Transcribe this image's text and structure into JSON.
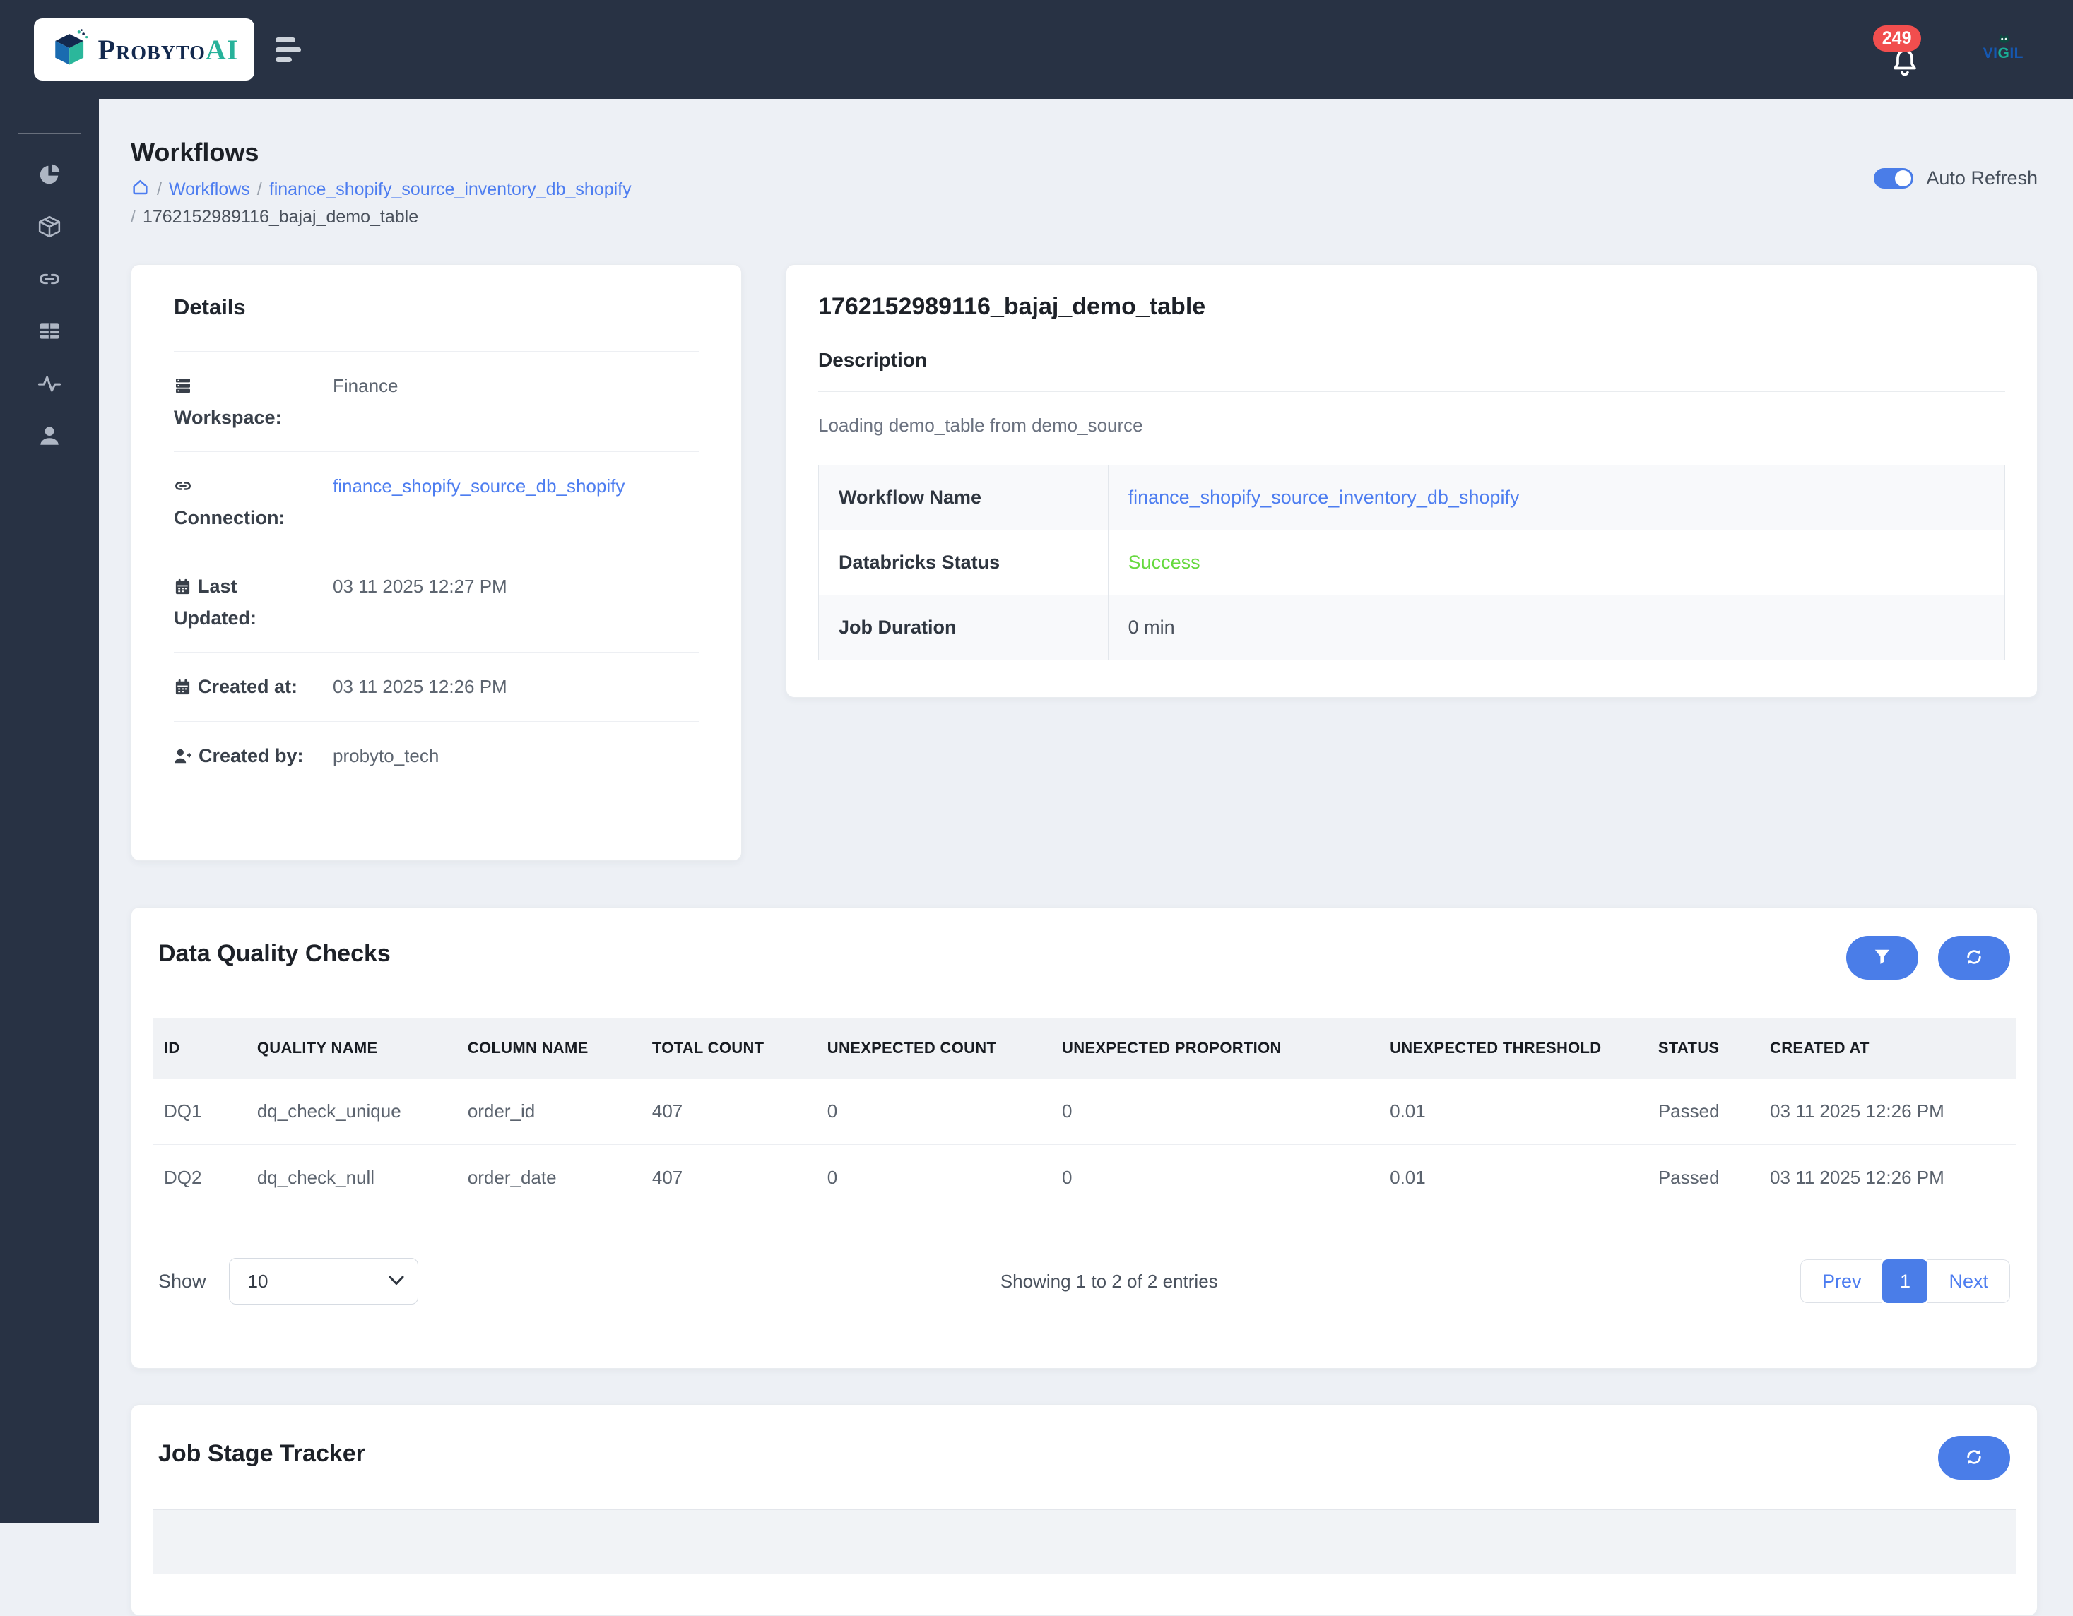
{
  "navbar": {
    "brand_name": "Probyto",
    "brand_suffix": "AI",
    "notification_count": "249",
    "vigil_label": "VIGIL"
  },
  "sidebar": {
    "icons": [
      "pie-chart",
      "package",
      "link",
      "table",
      "activity",
      "user"
    ]
  },
  "page": {
    "title": "Workflows",
    "breadcrumb": {
      "sep": "/",
      "items": [
        "Workflows",
        "finance_shopify_source_inventory_db_shopify",
        "1762152989116_bajaj_demo_table"
      ]
    },
    "auto_refresh_label": "Auto Refresh"
  },
  "details": {
    "title": "Details",
    "rows": [
      {
        "icon": "server-icon",
        "label": "Workspace:",
        "value": "Finance"
      },
      {
        "icon": "link-icon",
        "label": "Connection:",
        "value": "finance_shopify_source_db_shopify"
      },
      {
        "icon": "calendar-icon",
        "label": "Last Updated:",
        "value": "03 11 2025 12:27 PM"
      },
      {
        "icon": "calendar-icon",
        "label": "Created at:",
        "value": "03 11 2025 12:26 PM"
      },
      {
        "icon": "user-plus-icon",
        "label": "Created by:",
        "value": "probyto_tech"
      }
    ]
  },
  "workflow": {
    "title": "1762152989116_bajaj_demo_table",
    "description_label": "Description",
    "description": "Loading demo_table from demo_source",
    "info": [
      {
        "label": "Workflow Name",
        "value": "finance_shopify_source_inventory_db_shopify",
        "type": "link"
      },
      {
        "label": "Databricks Status",
        "value": "Success",
        "type": "success"
      },
      {
        "label": "Job Duration",
        "value": "0 min",
        "type": "plain"
      }
    ]
  },
  "dq": {
    "title": "Data Quality Checks",
    "columns": [
      "ID",
      "QUALITY NAME",
      "COLUMN NAME",
      "TOTAL COUNT",
      "UNEXPECTED COUNT",
      "UNEXPECTED PROPORTION",
      "UNEXPECTED THRESHOLD",
      "STATUS",
      "CREATED AT"
    ],
    "rows": [
      [
        "DQ1",
        "dq_check_unique",
        "order_id",
        "407",
        "0",
        "0",
        "0.01",
        "Passed",
        "03 11 2025 12:26 PM"
      ],
      [
        "DQ2",
        "dq_check_null",
        "order_date",
        "407",
        "0",
        "0",
        "0.01",
        "Passed",
        "03 11 2025 12:26 PM"
      ]
    ],
    "show_label": "Show",
    "page_size": "10",
    "summary": "Showing 1 to 2 of 2 entries",
    "pagination": {
      "prev": "Prev",
      "current": "1",
      "next": "Next"
    }
  },
  "jst": {
    "title": "Job Stage Tracker"
  },
  "colors": {
    "accent_blue": "#4a7de8",
    "link_blue": "#4d7df0",
    "success_green": "#66d93e",
    "badge_red": "#f14e4e",
    "navbar_dark": "#283244"
  }
}
